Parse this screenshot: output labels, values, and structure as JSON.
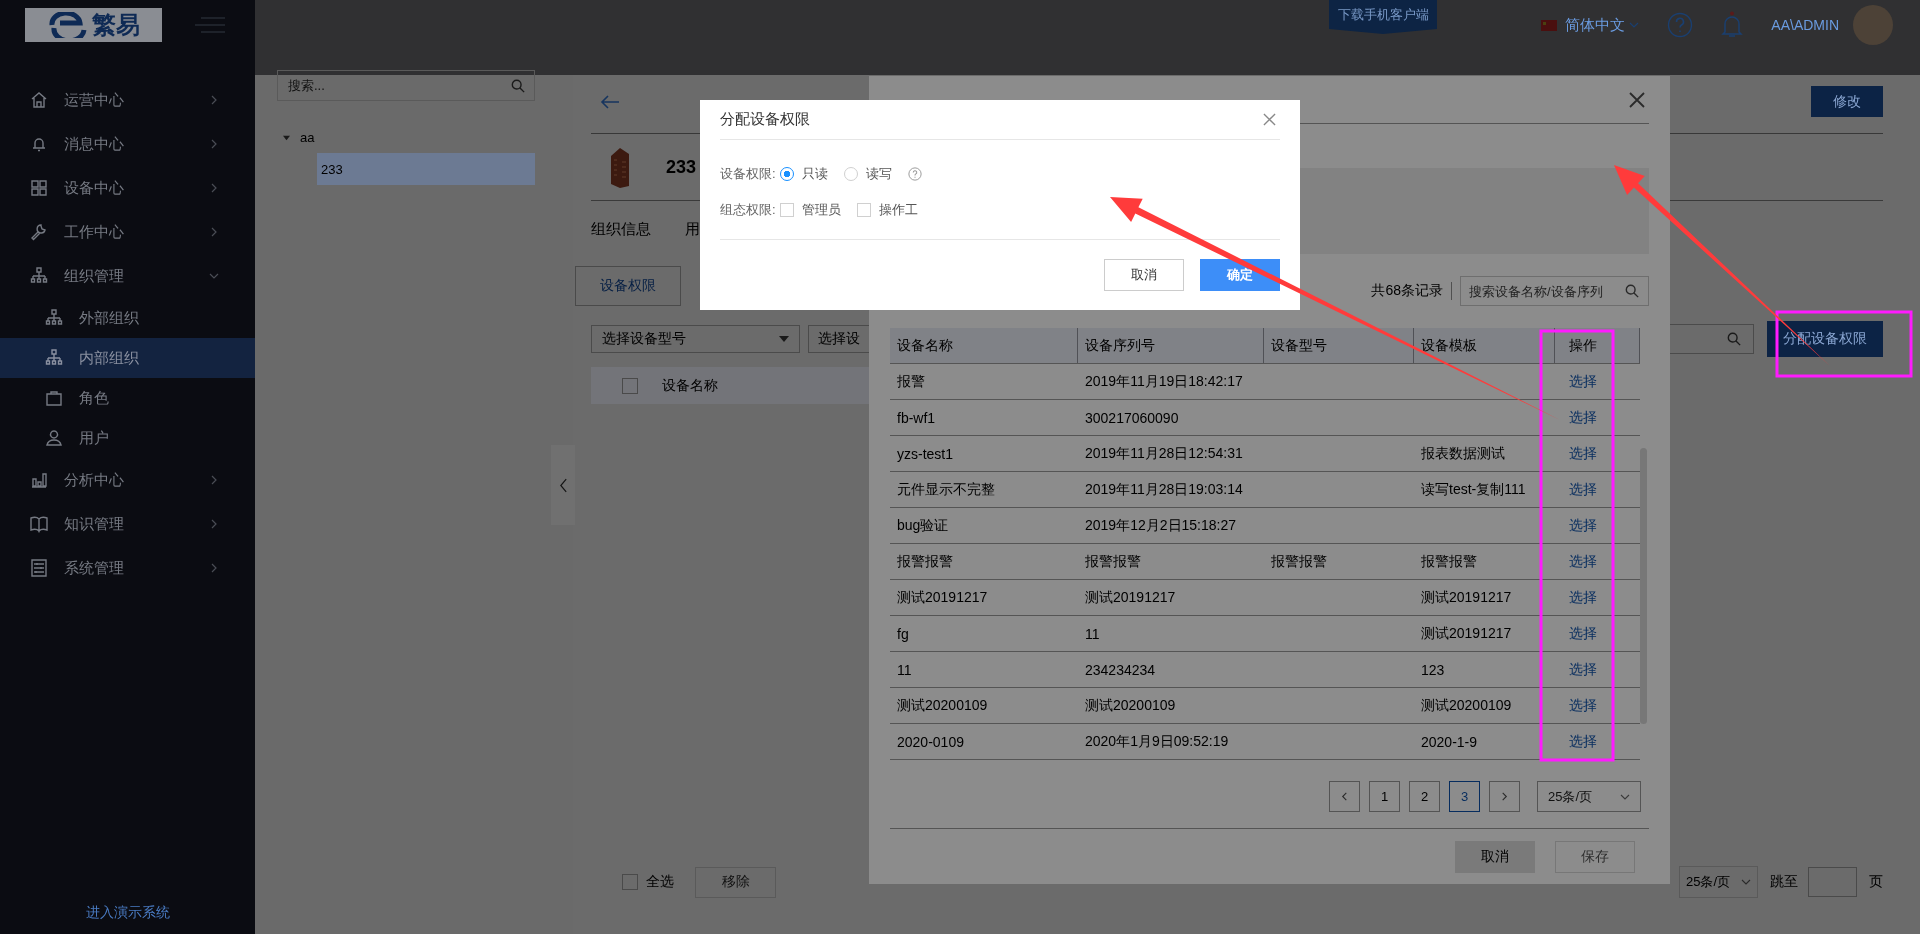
{
  "sidebar": {
    "logo_text": "繁易",
    "items": [
      {
        "label": "运营中心",
        "expanded": false
      },
      {
        "label": "消息中心",
        "expanded": false
      },
      {
        "label": "设备中心",
        "expanded": false
      },
      {
        "label": "工作中心",
        "expanded": false
      },
      {
        "label": "组织管理",
        "expanded": true,
        "children": [
          {
            "label": "外部组织",
            "selected": false
          },
          {
            "label": "内部组织",
            "selected": true
          },
          {
            "label": "角色",
            "selected": false
          },
          {
            "label": "用户",
            "selected": false
          }
        ]
      },
      {
        "label": "分析中心",
        "expanded": false
      },
      {
        "label": "知识管理",
        "expanded": false
      },
      {
        "label": "系统管理",
        "expanded": false
      }
    ],
    "demo_link": "进入演示系统"
  },
  "header": {
    "download_badge": "下载手机客户端",
    "language": "简体中文",
    "user": "AA\\ADMIN"
  },
  "tree": {
    "search_placeholder": "搜索...",
    "nodes": [
      {
        "label": "aa",
        "selected": false,
        "children": [
          {
            "label": "233",
            "selected": true
          }
        ]
      }
    ]
  },
  "org": {
    "edit_button": "修改",
    "title": "233",
    "tabs": [
      {
        "label": "组织信息",
        "selected": false
      },
      {
        "label": "用",
        "selected": false
      }
    ],
    "subtabs": [
      {
        "label": "设备权限",
        "selected": true
      }
    ],
    "model_select_placeholder": "选择设备型号",
    "device_input_placeholder": "选择设",
    "assign_button": "分配设备权限",
    "header_checkbox_checked": false,
    "columns": [
      "设备名称"
    ],
    "select_all": {
      "label": "全选",
      "checked": false
    },
    "remove_button": "移除",
    "pagination": {
      "page_size": "25条/页",
      "jump_label": "跳至",
      "page_unit": "页"
    }
  },
  "device_dialog": {
    "total": "共68条记录",
    "search_placeholder": "搜索设备名称/设备序列",
    "columns": [
      "设备名称",
      "设备序列号",
      "设备型号",
      "设备模板",
      "操作"
    ],
    "rows": [
      {
        "name": "报警",
        "serial": "2019年11月19日18:42:17",
        "action": "选择"
      },
      {
        "name": "fb-wf1",
        "serial": "300217060090",
        "action": "选择"
      },
      {
        "name": "yzs-test1",
        "serial": "2019年11月28日12:54:31",
        "template": "报表数据测试",
        "action": "选择"
      },
      {
        "name": "元件显示不完整",
        "serial": "2019年11月28日19:03:14",
        "template": "读写test-复制111",
        "action": "选择"
      },
      {
        "name": "bug验证",
        "serial": "2019年12月2日15:18:27",
        "action": "选择"
      },
      {
        "name": "报警报警",
        "serial": "报警报警",
        "model": "报警报警",
        "template": "报警报警",
        "action": "选择"
      },
      {
        "name": "测试20191217",
        "serial": "测试20191217",
        "template": "测试20191217",
        "action": "选择"
      },
      {
        "name": "fg",
        "serial": "11",
        "template": "测试20191217",
        "action": "选择"
      },
      {
        "name": "11",
        "serial": "234234234",
        "template": "123",
        "action": "选择"
      },
      {
        "name": "测试20200109",
        "serial": "测试20200109",
        "template": "测试20200109",
        "action": "选择"
      },
      {
        "name": "2020-0109",
        "serial": "2020年1月9日09:52:19",
        "template": "2020-1-9",
        "action": "选择"
      }
    ],
    "pages": [
      {
        "label": "1",
        "selected": false
      },
      {
        "label": "2",
        "selected": false
      },
      {
        "label": "3",
        "selected": true
      }
    ],
    "page_size": "25条/页",
    "cancel_button": "取消",
    "save_button": {
      "label": "保存",
      "disabled": true
    }
  },
  "permission_dialog": {
    "title": "分配设备权限",
    "device_permission": {
      "label": "设备权限:",
      "options": [
        {
          "label": "只读",
          "selected": true
        },
        {
          "label": "读写",
          "selected": false
        }
      ]
    },
    "config_permission": {
      "label": "组态权限:",
      "options": [
        {
          "label": "管理员",
          "checked": false
        },
        {
          "label": "操作工",
          "checked": false
        }
      ]
    },
    "cancel_button": "取消",
    "confirm_button": "确定"
  }
}
